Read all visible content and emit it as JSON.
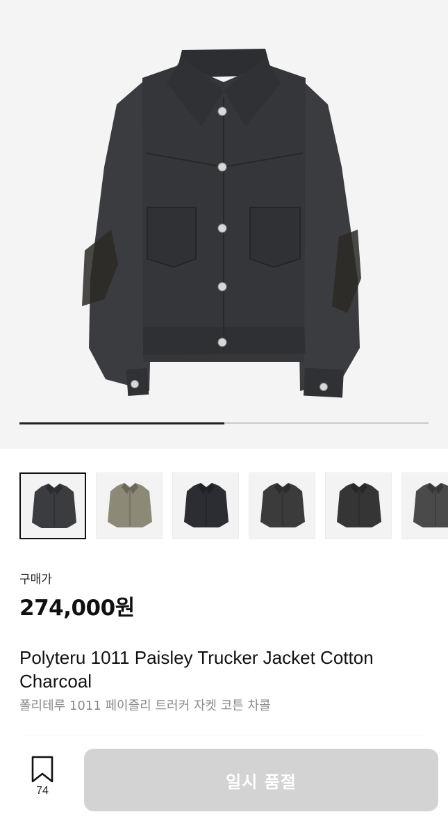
{
  "gallery": {
    "progress_fraction": 0.5,
    "thumbnails": [
      {
        "label": "jacket-charcoal-front",
        "color": "#3a3c3f",
        "active": true
      },
      {
        "label": "jacket-camo-front",
        "color": "#8c8a76",
        "active": false
      },
      {
        "label": "jacket-black-front",
        "color": "#2b2d33",
        "active": false
      },
      {
        "label": "jacket-darkgray-front",
        "color": "#3b3b3b",
        "active": false
      },
      {
        "label": "jacket-black-variant",
        "color": "#353535",
        "active": false
      },
      {
        "label": "jacket-gray-partial",
        "color": "#4a4a4a",
        "active": false
      }
    ]
  },
  "product": {
    "price_label": "구매가",
    "price": "274,000원",
    "title_en": "Polyteru 1011 Paisley Trucker Jacket Cotton Charcoal",
    "title_ko": "폴리테루 1011 페이즐리 트러커 자켓 코튼 차콜"
  },
  "actions": {
    "bookmark_count": "74",
    "buy_button_label": "일시 품절"
  },
  "colors": {
    "accent_disabled": "#d3d3d3",
    "price_text": "#111111",
    "subtitle_text": "#8a8a8a"
  }
}
